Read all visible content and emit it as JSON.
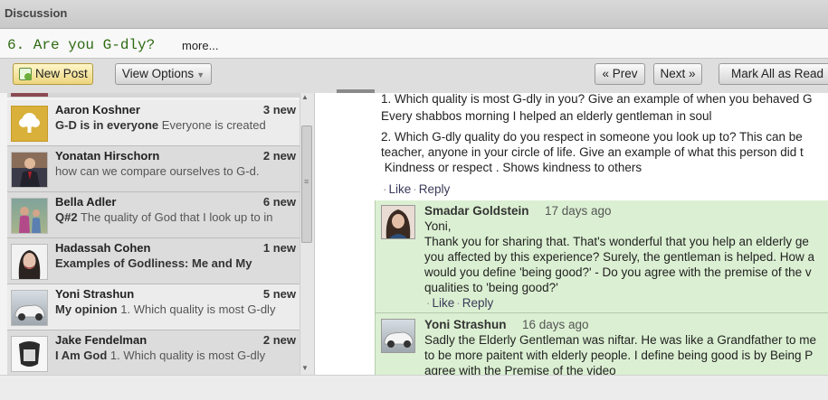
{
  "header": {
    "title": "Discussion"
  },
  "question": {
    "title": "6. Are you G-dly?",
    "more": "more..."
  },
  "toolbar": {
    "new_post": "New Post",
    "view_options": "View Options",
    "prev": "« Prev",
    "next": "Next »",
    "mark_all_read": "Mark All as Read"
  },
  "threads": [
    {
      "name": "Aaron Koshner",
      "new": "3 new",
      "title": "G-D is in everyone",
      "snippet": "Everyone is created"
    },
    {
      "name": "Yonatan Hirschorn",
      "new": "2 new",
      "title": "",
      "snippet": "how can we compare ourselves to G-d."
    },
    {
      "name": "Bella Adler",
      "new": "6 new",
      "title": "Q#2",
      "snippet": "The quality of God that I look up to in"
    },
    {
      "name": "Hadassah Cohen",
      "new": "1 new",
      "title": "Examples of Godliness: Me and My",
      "snippet": ""
    },
    {
      "name": "Yoni Strashun",
      "new": "5 new",
      "title": "My opinion",
      "snippet": "1. Which quality is most G-dly"
    },
    {
      "name": "Jake Fendelman",
      "new": "2 new",
      "title": "I Am God",
      "snippet": "1. Which quality is most G-dly"
    }
  ],
  "post": {
    "lines": [
      "1. Which quality is most G-dly in you? Give an example of when you behaved G",
      "Every shabbos morning I helped an elderly gentleman in soul",
      "2. Which G-dly quality do you respect in someone you look up to? This can be",
      "teacher, anyone in your circle of life. Give an example of what this person did t",
      " Kindness or respect . Shows kindness to others"
    ],
    "like": "Like",
    "reply": "Reply"
  },
  "replies": [
    {
      "name": "Smadar Goldstein",
      "time": "17 days ago",
      "lines": [
        "Yoni,",
        "Thank you for sharing that. That's wonderful that you help an elderly ge",
        "you affected by this experience? Surely, the gentleman is helped. How a",
        "would you define 'being good?' - Do you agree with the premise of the v",
        "qualities to 'being good?'"
      ],
      "like": "Like",
      "reply": "Reply"
    },
    {
      "name": "Yoni Strashun",
      "time": "16 days ago",
      "lines": [
        "Sadly the Elderly Gentleman was niftar. He was like a Grandfather to me",
        "to be more paitent with elderly people. I define being good is by Being P",
        "agree with the Premise of the video"
      ]
    }
  ]
}
